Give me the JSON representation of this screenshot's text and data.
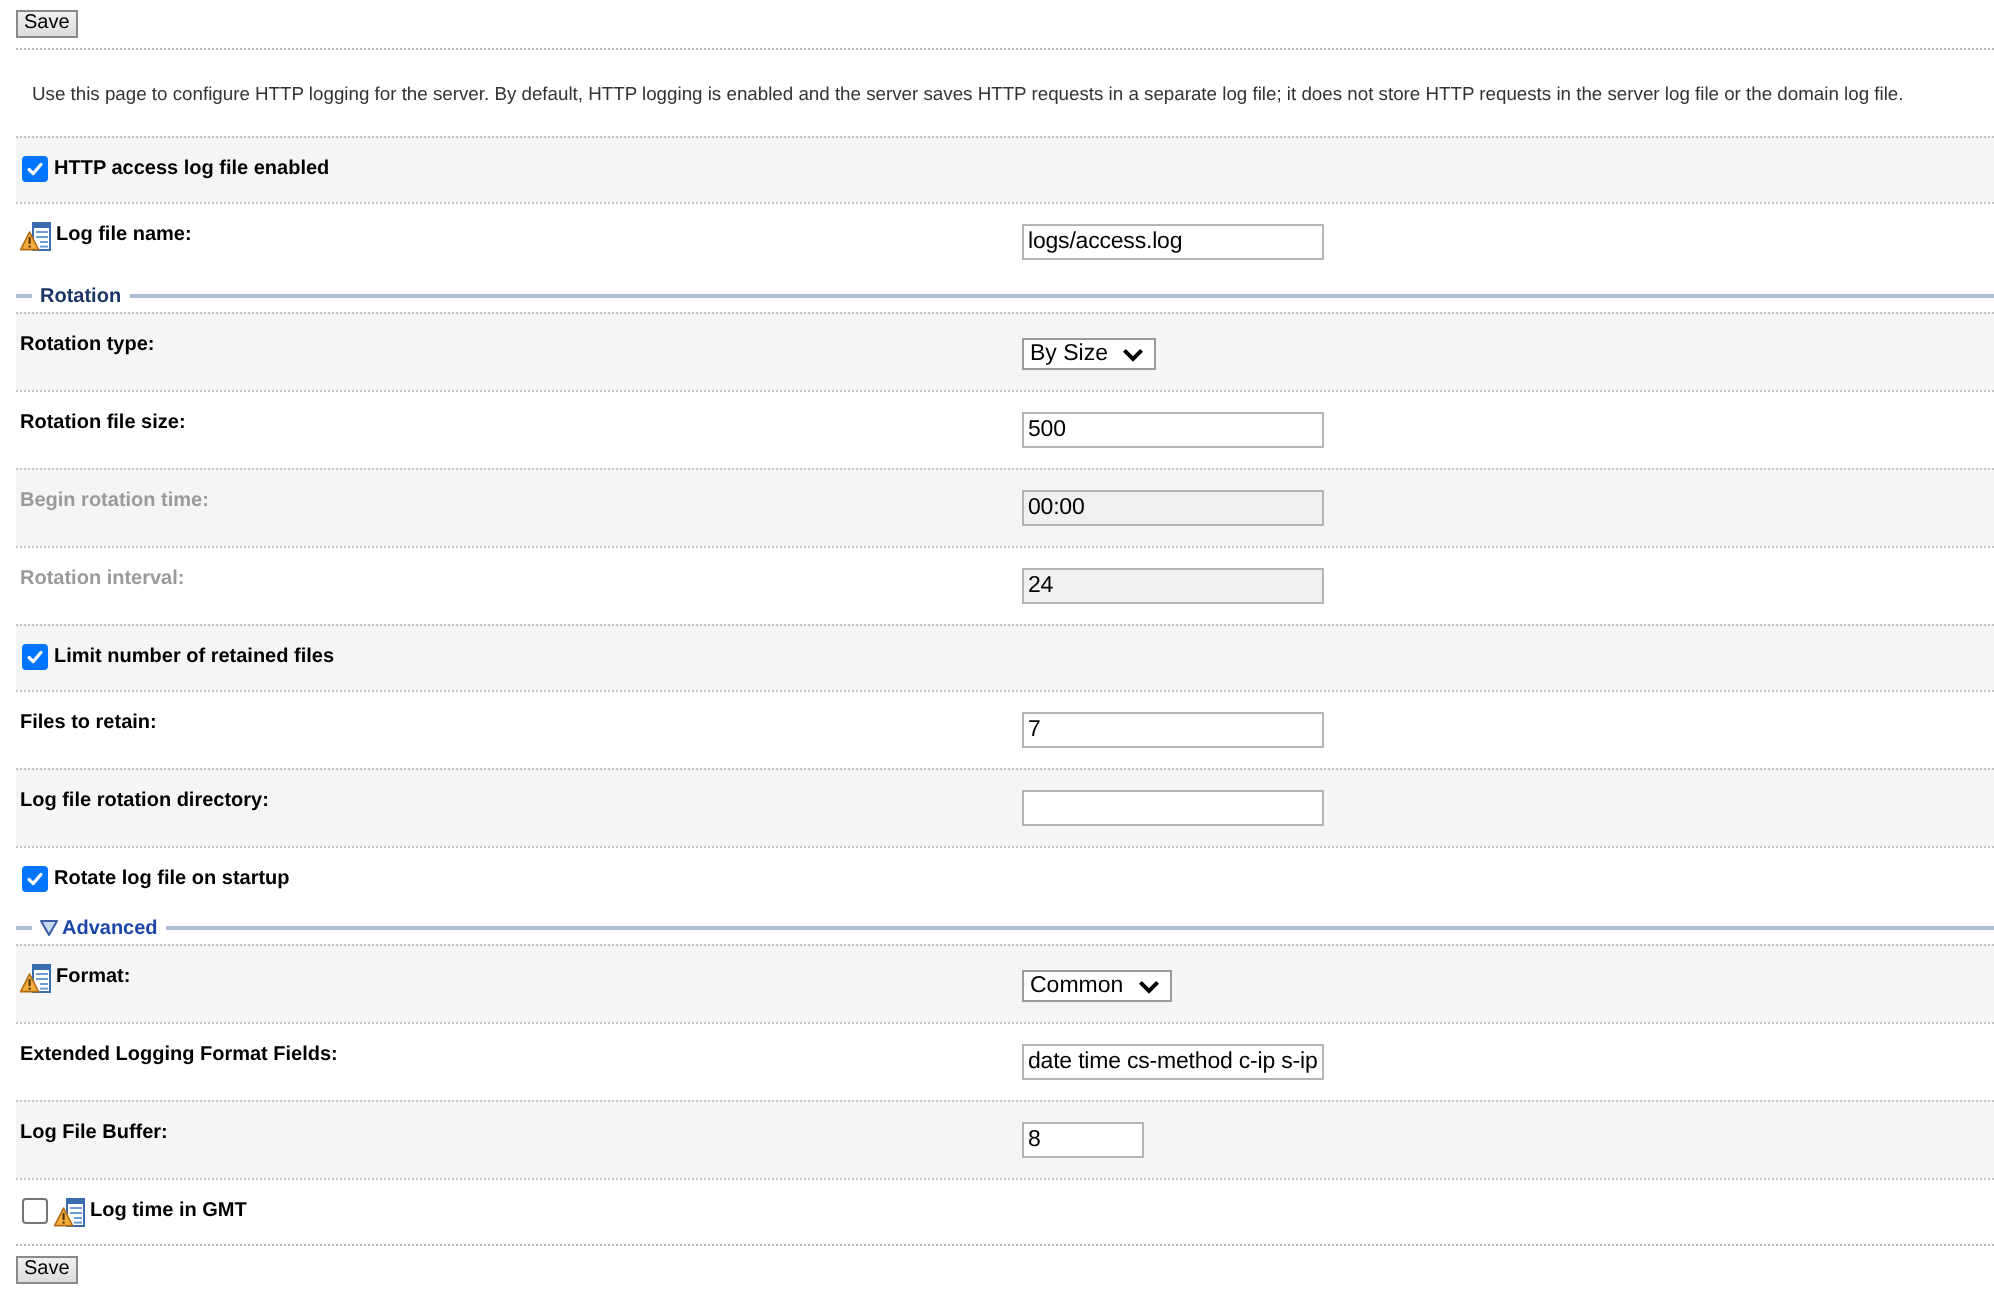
{
  "top_bar": {
    "button": "Save"
  },
  "intro": "Use this page to configure HTTP logging for the server. By default, HTTP logging is enabled and the server saves HTTP requests in a separate log file; it does not store HTTP requests in the server log file or the domain log file.",
  "sections": [
    {
      "rows": [
        {
          "kind": "checkbox",
          "label": "HTTP access log file enabled",
          "checked": true,
          "disabled": false,
          "warning_icon": false
        },
        {
          "kind": "text",
          "label": "Log file name:",
          "value": "logs/access.log",
          "disabled": false,
          "warning_icon": true
        }
      ]
    },
    {
      "title": "Rotation",
      "collapsible": false,
      "rows": [
        {
          "kind": "select",
          "label": "Rotation type:",
          "value": "By Size",
          "disabled": false,
          "warning_icon": false
        },
        {
          "kind": "text",
          "label": "Rotation file size:",
          "value": "500",
          "disabled": false,
          "warning_icon": false
        },
        {
          "kind": "text",
          "label": "Begin rotation time:",
          "value": "00:00",
          "disabled": true,
          "warning_icon": false
        },
        {
          "kind": "text",
          "label": "Rotation interval:",
          "value": "24",
          "disabled": true,
          "warning_icon": false
        },
        {
          "kind": "checkbox",
          "label": "Limit number of retained files",
          "checked": true,
          "disabled": false,
          "warning_icon": false
        },
        {
          "kind": "text",
          "label": "Files to retain:",
          "value": "7",
          "disabled": false,
          "warning_icon": false
        },
        {
          "kind": "text",
          "label": "Log file rotation directory:",
          "disabled": false,
          "warning_icon": false
        },
        {
          "kind": "checkbox",
          "label": "Rotate log file on startup",
          "checked": true,
          "disabled": false,
          "warning_icon": false
        }
      ]
    },
    {
      "title": "Advanced",
      "collapsible": true,
      "expanded": true,
      "rows": [
        {
          "kind": "select",
          "label": "Format:",
          "value": "Common",
          "disabled": false,
          "warning_icon": true
        },
        {
          "kind": "text",
          "label": "Extended Logging Format Fields:",
          "value": "date time cs-method c-ip s-ip",
          "disabled": false,
          "warning_icon": false
        },
        {
          "kind": "short",
          "label": "Log File Buffer:",
          "value": "8",
          "disabled": false,
          "warning_icon": false
        },
        {
          "kind": "checkbox",
          "label": "Log time in GMT",
          "checked": false,
          "disabled": false,
          "warning_icon": true
        }
      ]
    }
  ],
  "bottom_bar": {
    "button": "Save"
  }
}
